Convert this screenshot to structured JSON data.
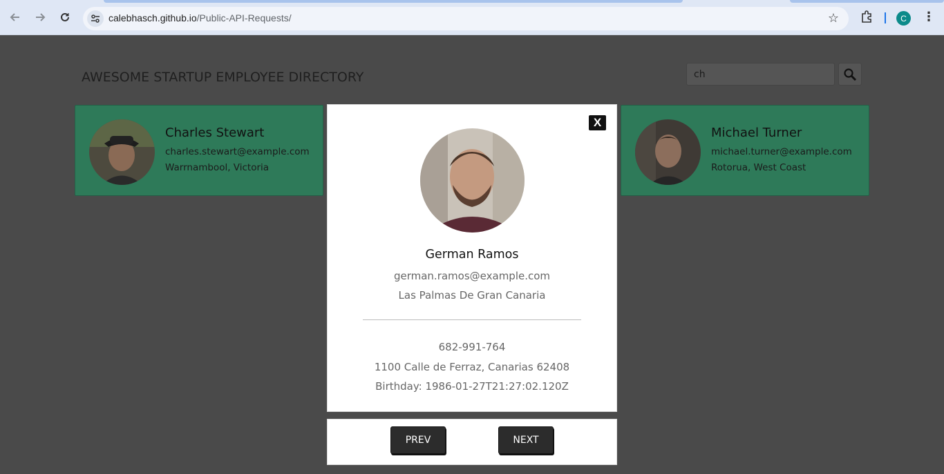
{
  "browser": {
    "url_host": "calebhasch.github.io",
    "url_path": "/Public-API-Requests/",
    "profile_initial": "C"
  },
  "page": {
    "title": "AWESOME STARTUP EMPLOYEE DIRECTORY",
    "search": {
      "value": "ch"
    }
  },
  "cards": [
    {
      "name": "Charles Stewart",
      "email": "charles.stewart@example.com",
      "location": "Warrnambool, Victoria"
    },
    {
      "name": "Michael Turner",
      "email": "michael.turner@example.com",
      "location": "Rotorua, West Coast"
    }
  ],
  "modal": {
    "close_label": "X",
    "name": "German Ramos",
    "email": "german.ramos@example.com",
    "city": "Las Palmas De Gran Canaria",
    "phone": "682-991-764",
    "address": "1100 Calle de Ferraz, Canarias 62408",
    "birthday": "Birthday: 1986-01-27T21:27:02.120Z"
  },
  "modal_nav": {
    "prev_label": "PREV",
    "next_label": "NEXT"
  },
  "colors": {
    "card_bg": "#2e7a59",
    "overlay_bg": "#4a4a4a",
    "button_bg": "#2c2c2c"
  }
}
